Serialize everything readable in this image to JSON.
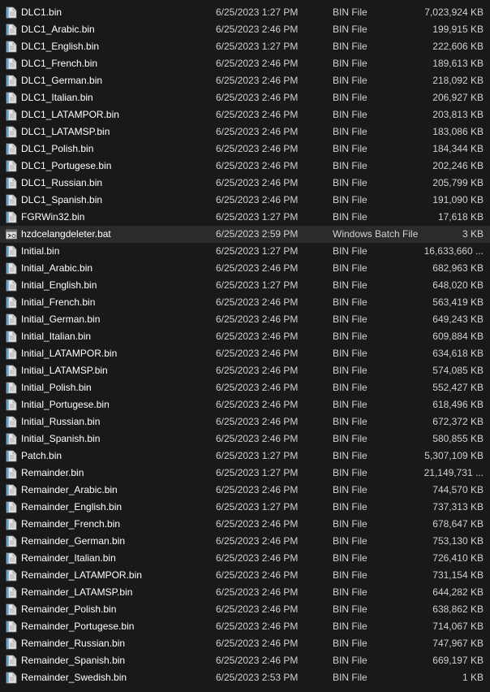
{
  "files": [
    {
      "name": "DLC1.bin",
      "date": "6/25/2023 1:27 PM",
      "type": "BIN File",
      "size": "7,023,924 KB",
      "icon": "bin-file-icon"
    },
    {
      "name": "DLC1_Arabic.bin",
      "date": "6/25/2023 2:46 PM",
      "type": "BIN File",
      "size": "199,915 KB",
      "icon": "bin-file-icon"
    },
    {
      "name": "DLC1_English.bin",
      "date": "6/25/2023 1:27 PM",
      "type": "BIN File",
      "size": "222,606 KB",
      "icon": "bin-file-icon"
    },
    {
      "name": "DLC1_French.bin",
      "date": "6/25/2023 2:46 PM",
      "type": "BIN File",
      "size": "189,613 KB",
      "icon": "bin-file-icon"
    },
    {
      "name": "DLC1_German.bin",
      "date": "6/25/2023 2:46 PM",
      "type": "BIN File",
      "size": "218,092 KB",
      "icon": "bin-file-icon"
    },
    {
      "name": "DLC1_Italian.bin",
      "date": "6/25/2023 2:46 PM",
      "type": "BIN File",
      "size": "206,927 KB",
      "icon": "bin-file-icon"
    },
    {
      "name": "DLC1_LATAMPOR.bin",
      "date": "6/25/2023 2:46 PM",
      "type": "BIN File",
      "size": "203,813 KB",
      "icon": "bin-file-icon"
    },
    {
      "name": "DLC1_LATAMSP.bin",
      "date": "6/25/2023 2:46 PM",
      "type": "BIN File",
      "size": "183,086 KB",
      "icon": "bin-file-icon"
    },
    {
      "name": "DLC1_Polish.bin",
      "date": "6/25/2023 2:46 PM",
      "type": "BIN File",
      "size": "184,344 KB",
      "icon": "bin-file-icon"
    },
    {
      "name": "DLC1_Portugese.bin",
      "date": "6/25/2023 2:46 PM",
      "type": "BIN File",
      "size": "202,246 KB",
      "icon": "bin-file-icon"
    },
    {
      "name": "DLC1_Russian.bin",
      "date": "6/25/2023 2:46 PM",
      "type": "BIN File",
      "size": "205,799 KB",
      "icon": "bin-file-icon"
    },
    {
      "name": "DLC1_Spanish.bin",
      "date": "6/25/2023 2:46 PM",
      "type": "BIN File",
      "size": "191,090 KB",
      "icon": "bin-file-icon"
    },
    {
      "name": "FGRWin32.bin",
      "date": "6/25/2023 1:27 PM",
      "type": "BIN File",
      "size": "17,618 KB",
      "icon": "bin-file-icon"
    },
    {
      "name": "hzdcelangdeleter.bat",
      "date": "6/25/2023 2:59 PM",
      "type": "Windows Batch File",
      "size": "3 KB",
      "icon": "batch-file-icon",
      "selected": true
    },
    {
      "name": "Initial.bin",
      "date": "6/25/2023 1:27 PM",
      "type": "BIN File",
      "size": "16,633,660 ...",
      "icon": "bin-file-icon"
    },
    {
      "name": "Initial_Arabic.bin",
      "date": "6/25/2023 2:46 PM",
      "type": "BIN File",
      "size": "682,963 KB",
      "icon": "bin-file-icon"
    },
    {
      "name": "Initial_English.bin",
      "date": "6/25/2023 1:27 PM",
      "type": "BIN File",
      "size": "648,020 KB",
      "icon": "bin-file-icon"
    },
    {
      "name": "Initial_French.bin",
      "date": "6/25/2023 2:46 PM",
      "type": "BIN File",
      "size": "563,419 KB",
      "icon": "bin-file-icon"
    },
    {
      "name": "Initial_German.bin",
      "date": "6/25/2023 2:46 PM",
      "type": "BIN File",
      "size": "649,243 KB",
      "icon": "bin-file-icon"
    },
    {
      "name": "Initial_Italian.bin",
      "date": "6/25/2023 2:46 PM",
      "type": "BIN File",
      "size": "609,884 KB",
      "icon": "bin-file-icon"
    },
    {
      "name": "Initial_LATAMPOR.bin",
      "date": "6/25/2023 2:46 PM",
      "type": "BIN File",
      "size": "634,618 KB",
      "icon": "bin-file-icon"
    },
    {
      "name": "Initial_LATAMSP.bin",
      "date": "6/25/2023 2:46 PM",
      "type": "BIN File",
      "size": "574,085 KB",
      "icon": "bin-file-icon"
    },
    {
      "name": "Initial_Polish.bin",
      "date": "6/25/2023 2:46 PM",
      "type": "BIN File",
      "size": "552,427 KB",
      "icon": "bin-file-icon"
    },
    {
      "name": "Initial_Portugese.bin",
      "date": "6/25/2023 2:46 PM",
      "type": "BIN File",
      "size": "618,496 KB",
      "icon": "bin-file-icon"
    },
    {
      "name": "Initial_Russian.bin",
      "date": "6/25/2023 2:46 PM",
      "type": "BIN File",
      "size": "672,372 KB",
      "icon": "bin-file-icon"
    },
    {
      "name": "Initial_Spanish.bin",
      "date": "6/25/2023 2:46 PM",
      "type": "BIN File",
      "size": "580,855 KB",
      "icon": "bin-file-icon"
    },
    {
      "name": "Patch.bin",
      "date": "6/25/2023 1:27 PM",
      "type": "BIN File",
      "size": "5,307,109 KB",
      "icon": "bin-file-icon"
    },
    {
      "name": "Remainder.bin",
      "date": "6/25/2023 1:27 PM",
      "type": "BIN File",
      "size": "21,149,731 ...",
      "icon": "bin-file-icon"
    },
    {
      "name": "Remainder_Arabic.bin",
      "date": "6/25/2023 2:46 PM",
      "type": "BIN File",
      "size": "744,570 KB",
      "icon": "bin-file-icon"
    },
    {
      "name": "Remainder_English.bin",
      "date": "6/25/2023 1:27 PM",
      "type": "BIN File",
      "size": "737,313 KB",
      "icon": "bin-file-icon"
    },
    {
      "name": "Remainder_French.bin",
      "date": "6/25/2023 2:46 PM",
      "type": "BIN File",
      "size": "678,647 KB",
      "icon": "bin-file-icon"
    },
    {
      "name": "Remainder_German.bin",
      "date": "6/25/2023 2:46 PM",
      "type": "BIN File",
      "size": "753,130 KB",
      "icon": "bin-file-icon"
    },
    {
      "name": "Remainder_Italian.bin",
      "date": "6/25/2023 2:46 PM",
      "type": "BIN File",
      "size": "726,410 KB",
      "icon": "bin-file-icon"
    },
    {
      "name": "Remainder_LATAMPOR.bin",
      "date": "6/25/2023 2:46 PM",
      "type": "BIN File",
      "size": "731,154 KB",
      "icon": "bin-file-icon"
    },
    {
      "name": "Remainder_LATAMSP.bin",
      "date": "6/25/2023 2:46 PM",
      "type": "BIN File",
      "size": "644,282 KB",
      "icon": "bin-file-icon"
    },
    {
      "name": "Remainder_Polish.bin",
      "date": "6/25/2023 2:46 PM",
      "type": "BIN File",
      "size": "638,862 KB",
      "icon": "bin-file-icon"
    },
    {
      "name": "Remainder_Portugese.bin",
      "date": "6/25/2023 2:46 PM",
      "type": "BIN File",
      "size": "714,067 KB",
      "icon": "bin-file-icon"
    },
    {
      "name": "Remainder_Russian.bin",
      "date": "6/25/2023 2:46 PM",
      "type": "BIN File",
      "size": "747,967 KB",
      "icon": "bin-file-icon"
    },
    {
      "name": "Remainder_Spanish.bin",
      "date": "6/25/2023 2:46 PM",
      "type": "BIN File",
      "size": "669,197 KB",
      "icon": "bin-file-icon"
    },
    {
      "name": "Remainder_Swedish.bin",
      "date": "6/25/2023 2:53 PM",
      "type": "BIN File",
      "size": "1 KB",
      "icon": "bin-file-icon"
    }
  ],
  "colors": {
    "background": "#191919",
    "selected_row": "#2b2b2b",
    "text": "#ffffff",
    "secondary_text": "#d0d0d0",
    "file_icon_body": "#e8e8e8",
    "file_icon_accent": "#4aa3df"
  }
}
